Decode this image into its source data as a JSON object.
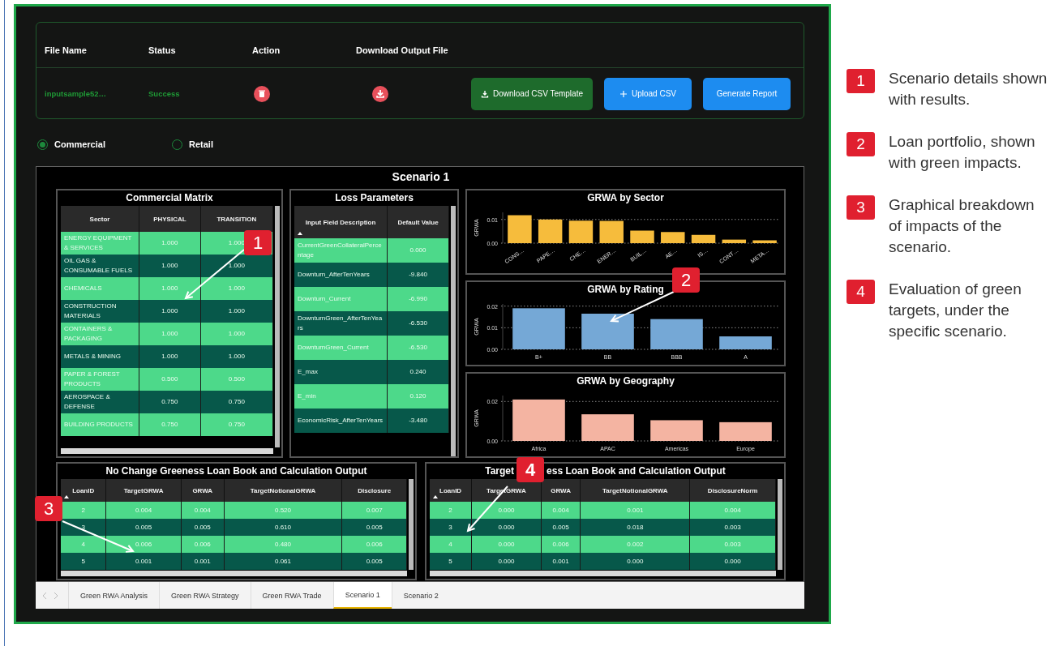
{
  "upload_table": {
    "columns": [
      "File Name",
      "Status",
      "Action",
      "Download Output File"
    ],
    "row": {
      "file_name": "inputsample52…",
      "status": "Success"
    }
  },
  "buttons": [
    {
      "kind": "template",
      "label": "Download CSV Template"
    },
    {
      "kind": "upload",
      "label": "Upload CSV"
    },
    {
      "kind": "generate",
      "label": "Generate Report"
    }
  ],
  "portfolio_type": [
    {
      "label": "Commercial",
      "selected": true
    },
    {
      "label": "Retail",
      "selected": false
    }
  ],
  "report": {
    "title": "Scenario 1",
    "commercial_matrix": {
      "title": "Commercial Matrix",
      "columns": [
        {
          "label": "Sector",
          "sorted": false
        },
        {
          "label": "PHYSICAL",
          "sorted": false
        },
        {
          "label": "TRANSITION",
          "sorted": false
        }
      ],
      "rows": [
        [
          "ENERGY EQUIPMENT & SERVICES",
          "1.000",
          "1.000"
        ],
        [
          "OIL GAS & CONSUMABLE FUELS",
          "1.000",
          "1.000"
        ],
        [
          "CHEMICALS",
          "1.000",
          "1.000"
        ],
        [
          "CONSTRUCTION MATERIALS",
          "1.000",
          "1.000"
        ],
        [
          "CONTAINERS & PACKAGING",
          "1.000",
          "1.000"
        ],
        [
          "METALS & MINING",
          "1.000",
          "1.000"
        ],
        [
          "PAPER & FOREST PRODUCTS",
          "0.500",
          "0.500"
        ],
        [
          "AEROSPACE & DEFENSE",
          "0.750",
          "0.750"
        ],
        [
          "BUILDING PRODUCTS",
          "0.750",
          "0.750"
        ]
      ]
    },
    "loss_parameters": {
      "title": "Loss Parameters",
      "columns": [
        {
          "label": "Input Field Description",
          "sorted": true
        },
        {
          "label": "Default Value",
          "sorted": false
        }
      ],
      "rows": [
        [
          "CurrentGreenCollateralPercentage",
          "0.000"
        ],
        [
          "Downturn_AfterTenYears",
          "-9.840"
        ],
        [
          "Downturn_Current",
          "-6.990"
        ],
        [
          "DownturnGreen_AfterTenYears",
          "-6.530"
        ],
        [
          "DownturnGreen_Current",
          "-6.530"
        ],
        [
          "E_max",
          "0.240"
        ],
        [
          "E_min",
          "0.120"
        ],
        [
          "EconomicRisk_AfterTenYears",
          "-3.480"
        ]
      ]
    },
    "charts": [
      {
        "chart_data": {
          "type": "bar",
          "title": "GRWA by Sector",
          "ylabel": "GRWA",
          "categories": [
            "CONS…",
            "PAPE…",
            "CHE…",
            "ENER…",
            "BUIL…",
            "AE…",
            "IS…",
            "CONT…",
            "META…"
          ],
          "series": [
            {
              "color": "#f6bc3c",
              "values": [
                0.0118,
                0.01,
                0.0095,
                0.0094,
                0.0053,
                0.0047,
                0.0035,
                0.0015,
                0.0012
              ]
            }
          ],
          "ylim": [
            0,
            0.013
          ],
          "yticks": [
            {
              "value": 0,
              "label": "0.00"
            },
            {
              "value": 0.01,
              "label": "0.01"
            }
          ]
        }
      },
      {
        "chart_data": {
          "type": "bar",
          "title": "GRWA by Rating",
          "ylabel": "GRWA",
          "categories": [
            "B+",
            "BB",
            "BBB",
            "A"
          ],
          "series": [
            {
              "color": "#75a8d6",
              "values": [
                0.019,
                0.0165,
                0.014,
                0.006
              ]
            }
          ],
          "ylim": [
            0,
            0.021
          ],
          "yticks": [
            {
              "value": 0,
              "label": "0.00"
            },
            {
              "value": 0.01,
              "label": "0.01"
            },
            {
              "value": 0.02,
              "label": "0.02"
            }
          ]
        }
      },
      {
        "chart_data": {
          "type": "bar",
          "title": "GRWA by Geography",
          "ylabel": "GRWA",
          "categories": [
            "Africa",
            "APAC",
            "Americas",
            "Europe"
          ],
          "series": [
            {
              "color": "#f4b4a2",
              "values": [
                0.021,
                0.0135,
                0.0105,
                0.0095
              ]
            }
          ],
          "ylim": [
            0,
            0.023
          ],
          "yticks": [
            {
              "value": 0,
              "label": "0.00"
            },
            {
              "value": 0.02,
              "label": "0.02"
            }
          ]
        }
      }
    ],
    "loan_tables": [
      {
        "title_parts": [
          "No Change Greeness Loan Book and Calculation Output"
        ],
        "columns": [
          {
            "label": "LoanID",
            "sorted": true
          },
          {
            "label": "TargetGRWA",
            "sorted": false
          },
          {
            "label": "GRWA",
            "sorted": false
          },
          {
            "label": "TargetNotionalGRWA",
            "sorted": false
          },
          {
            "label": "Disclosure",
            "sorted": false
          }
        ],
        "rows": [
          [
            "2",
            "0.004",
            "0.004",
            "0.520",
            "0.007"
          ],
          [
            "3",
            "0.005",
            "0.005",
            "0.610",
            "0.005"
          ],
          [
            "4",
            "0.006",
            "0.006",
            "0.480",
            "0.006"
          ],
          [
            "5",
            "0.001",
            "0.001",
            "0.061",
            "0.005"
          ]
        ]
      },
      {
        "title_parts": [
          "Target",
          "ess Loan Book and Calculation Output"
        ],
        "columns": [
          {
            "label": "LoanID",
            "sorted": true
          },
          {
            "label": "TargetGRWA",
            "sorted": false
          },
          {
            "label": "GRWA",
            "sorted": false
          },
          {
            "label": "TargetNotionalGRWA",
            "sorted": false
          },
          {
            "label": "DisclosureNorm",
            "sorted": false
          }
        ],
        "rows": [
          [
            "2",
            "0.000",
            "0.004",
            "0.001",
            "0.004"
          ],
          [
            "3",
            "0.000",
            "0.005",
            "0.018",
            "0.003"
          ],
          [
            "4",
            "0.000",
            "0.006",
            "0.002",
            "0.003"
          ],
          [
            "5",
            "0.000",
            "0.001",
            "0.000",
            "0.000"
          ]
        ]
      }
    ]
  },
  "page_tabs": [
    {
      "label": "Green RWA Analysis",
      "selected": false
    },
    {
      "label": "Green RWA Strategy",
      "selected": false
    },
    {
      "label": "Green RWA Trade",
      "selected": false
    },
    {
      "label": "Scenario 1",
      "selected": true
    },
    {
      "label": "Scenario 2",
      "selected": false
    }
  ],
  "callout_markers": [
    "1",
    "2",
    "3",
    "4"
  ],
  "legend": [
    {
      "number": "1",
      "text": "Scenario details shown with results."
    },
    {
      "number": "2",
      "text": "Loan portfolio, shown with green impacts."
    },
    {
      "number": "3",
      "text": "Graphical breakdown of impacts of the scenario."
    },
    {
      "number": "4",
      "text": "Evaluation of green targets, under the specific scenario."
    }
  ]
}
